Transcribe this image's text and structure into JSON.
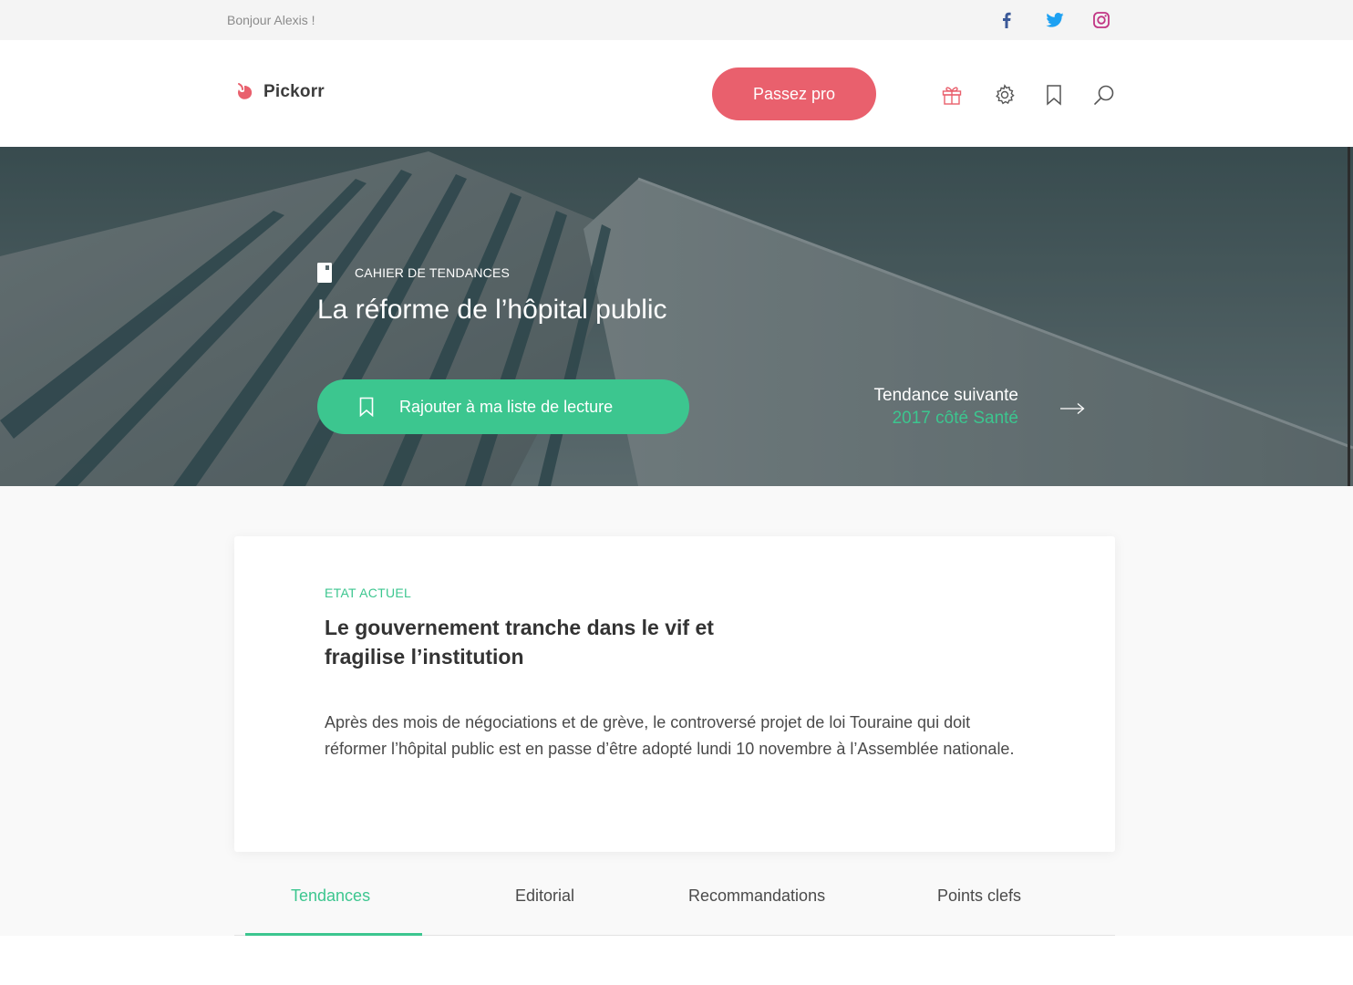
{
  "topbar": {
    "greeting": "Bonjour Alexis !",
    "social": [
      {
        "icon": "facebook-icon",
        "color": "#3b5998"
      },
      {
        "icon": "twitter-icon",
        "color": "#1da1f2"
      },
      {
        "icon": "instagram-icon",
        "color": "#c13584"
      }
    ]
  },
  "header": {
    "brand": "Pickorr",
    "pro_button": "Passez pro",
    "icons": [
      "gift-icon",
      "settings-icon",
      "bookmark-icon",
      "search-icon"
    ]
  },
  "hero": {
    "kicker": "CAHIER DE TENDANCES",
    "title": "La réforme de l’hôpital public",
    "read_button": "Rajouter à ma liste de lecture",
    "next_label": "Tendance suivante",
    "next_title": "2017 côté Santé"
  },
  "card": {
    "kicker": "ETAT ACTUEL",
    "title": "Le gouvernement tranche dans le vif et fragilise l’institution",
    "body": "Après des mois de négociations et de grève, le controversé projet de loi Touraine qui doit réformer l’hôpital public est en passe d’être adopté lundi 10 novembre à l’Assemblée nationale."
  },
  "tabs": [
    {
      "label": "Tendances",
      "active": true
    },
    {
      "label": "Editorial",
      "active": false
    },
    {
      "label": "Recommandations",
      "active": false
    },
    {
      "label": "Points clefs",
      "active": false
    }
  ],
  "colors": {
    "accent_green": "#3cc68f",
    "accent_red": "#e9606d"
  }
}
